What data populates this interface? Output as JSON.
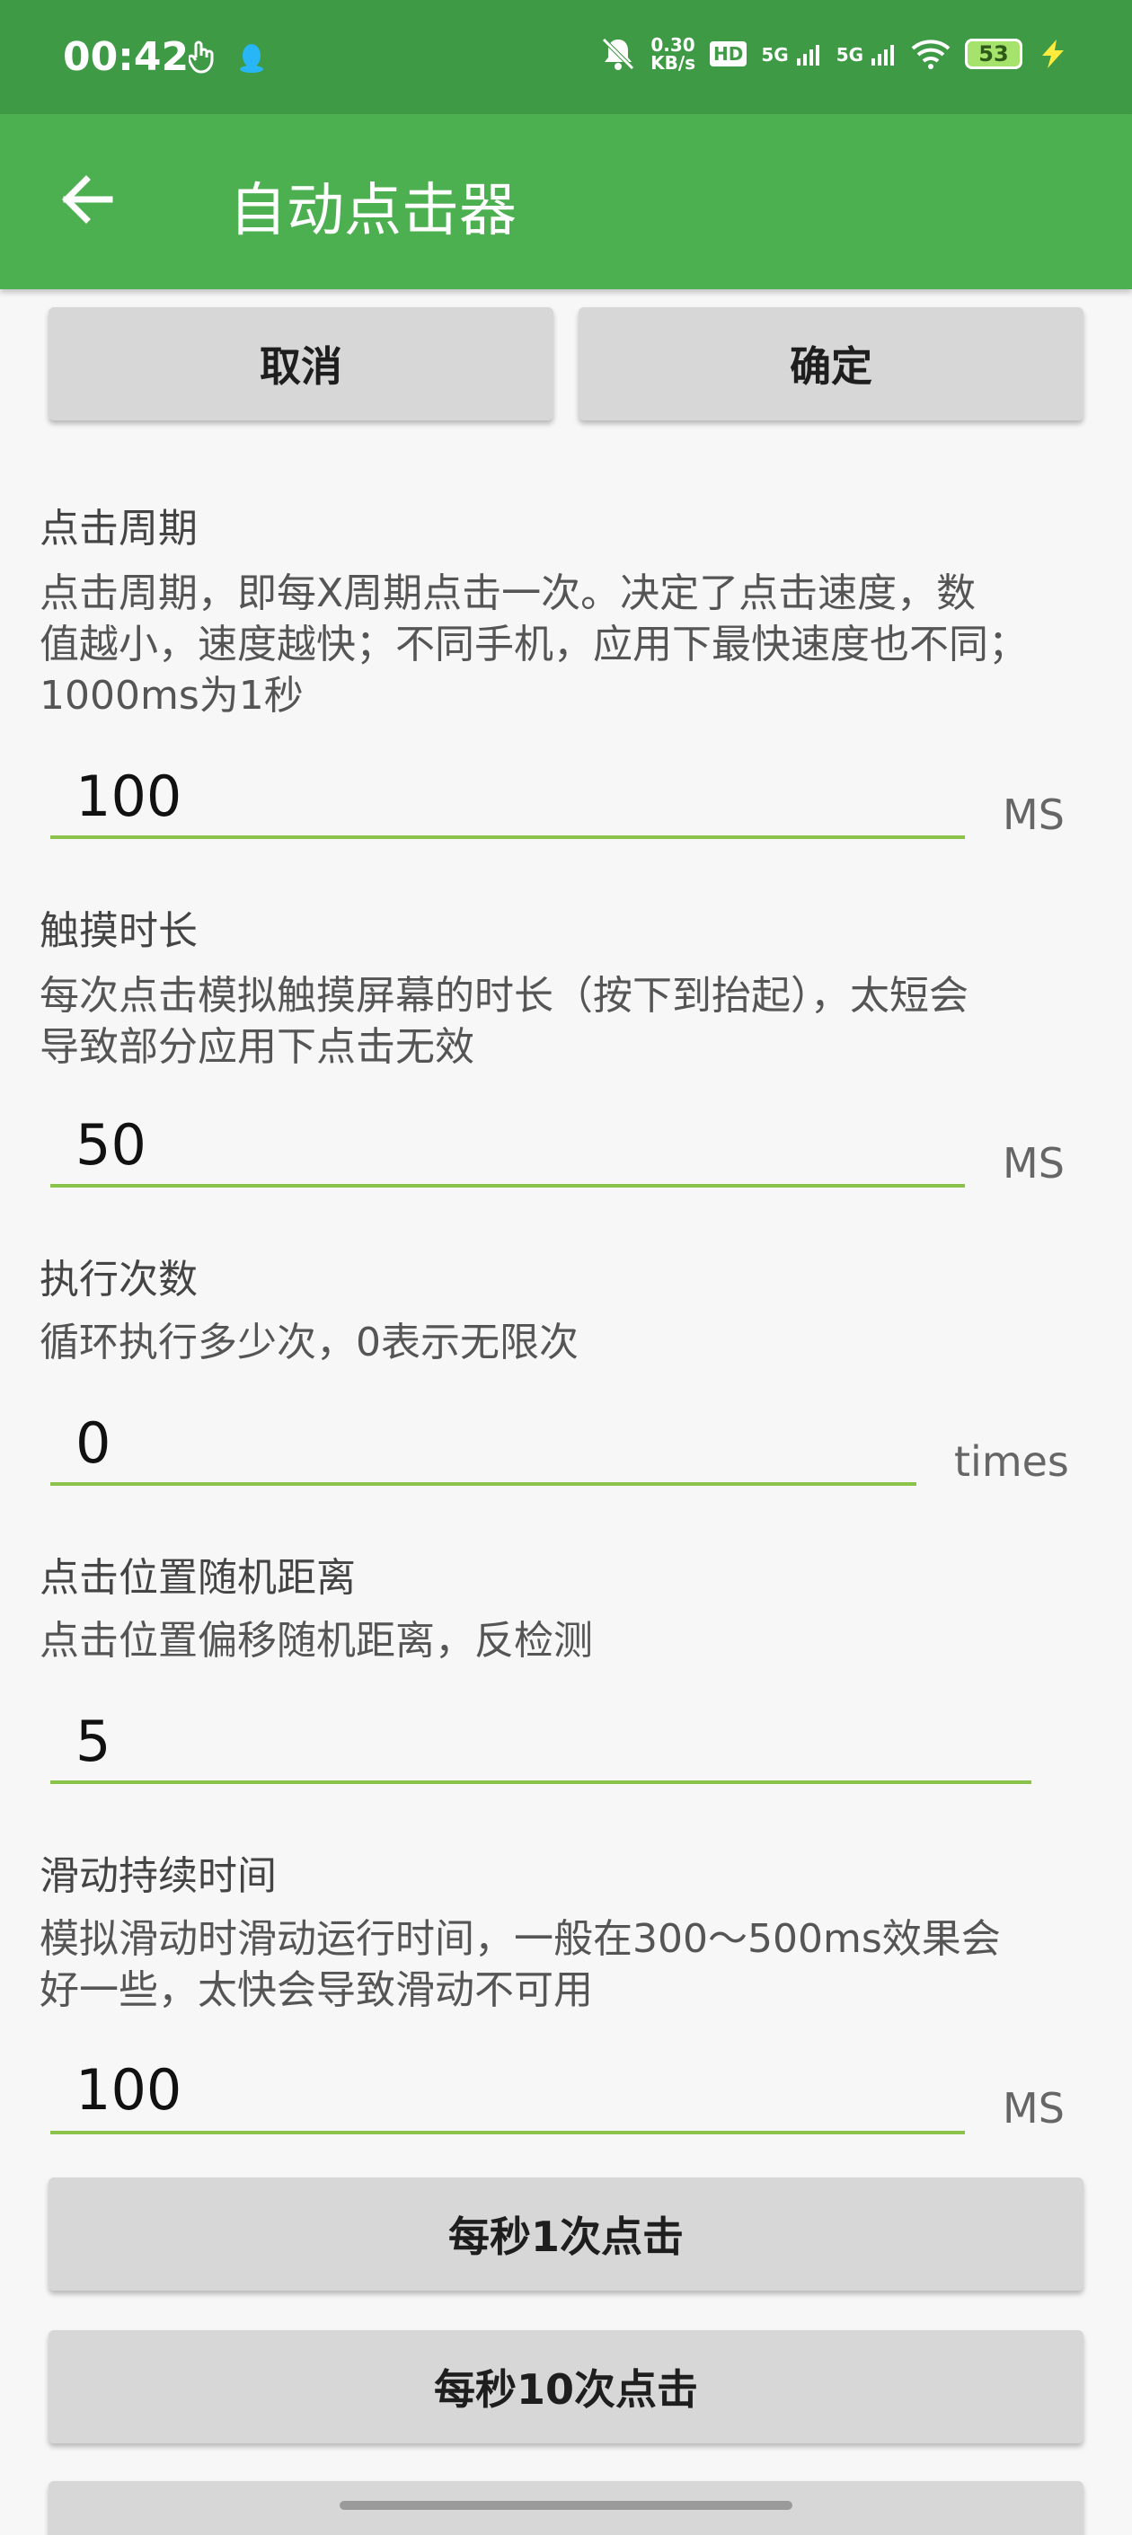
{
  "status_bar": {
    "time": "00:42",
    "net_speed_value": "0.30",
    "net_speed_unit": "KB/s",
    "hd_label": "HD",
    "signal1": "5G",
    "signal2": "5G",
    "battery": "53"
  },
  "app_bar": {
    "title": "自动点击器"
  },
  "actions": {
    "cancel_label": "取消",
    "confirm_label": "确定"
  },
  "sections": {
    "click_period": {
      "title": "点击周期",
      "desc_line1": "点击周期，即每X周期点击一次。决定了点击速度，数",
      "desc_line2": "值越小，速度越快；不同手机，应用下最快速度也不同；",
      "desc_line3": "1000ms为1秒",
      "value": "100",
      "unit": "MS"
    },
    "touch_duration": {
      "title": "触摸时长",
      "desc_line1": "每次点击模拟触摸屏幕的时长（按下到抬起），太短会",
      "desc_line2": "导致部分应用下点击无效",
      "value": "50",
      "unit": "MS"
    },
    "execute_count": {
      "title": "执行次数",
      "desc_line1": "循环执行多少次，0表示无限次",
      "value": "0",
      "unit": "times"
    },
    "random_offset": {
      "title": "点击位置随机距离",
      "desc_line1": "点击位置偏移随机距离，反检测",
      "value": "5"
    },
    "swipe_duration": {
      "title": "滑动持续时间",
      "desc_line1": "模拟滑动时滑动运行时间，一般在300～500ms效果会",
      "desc_line2": "好一些，太快会导致滑动不可用",
      "value": "100",
      "unit": "MS"
    }
  },
  "presets": {
    "preset1_label": "每秒1次点击",
    "preset10_label": "每秒10次点击"
  }
}
